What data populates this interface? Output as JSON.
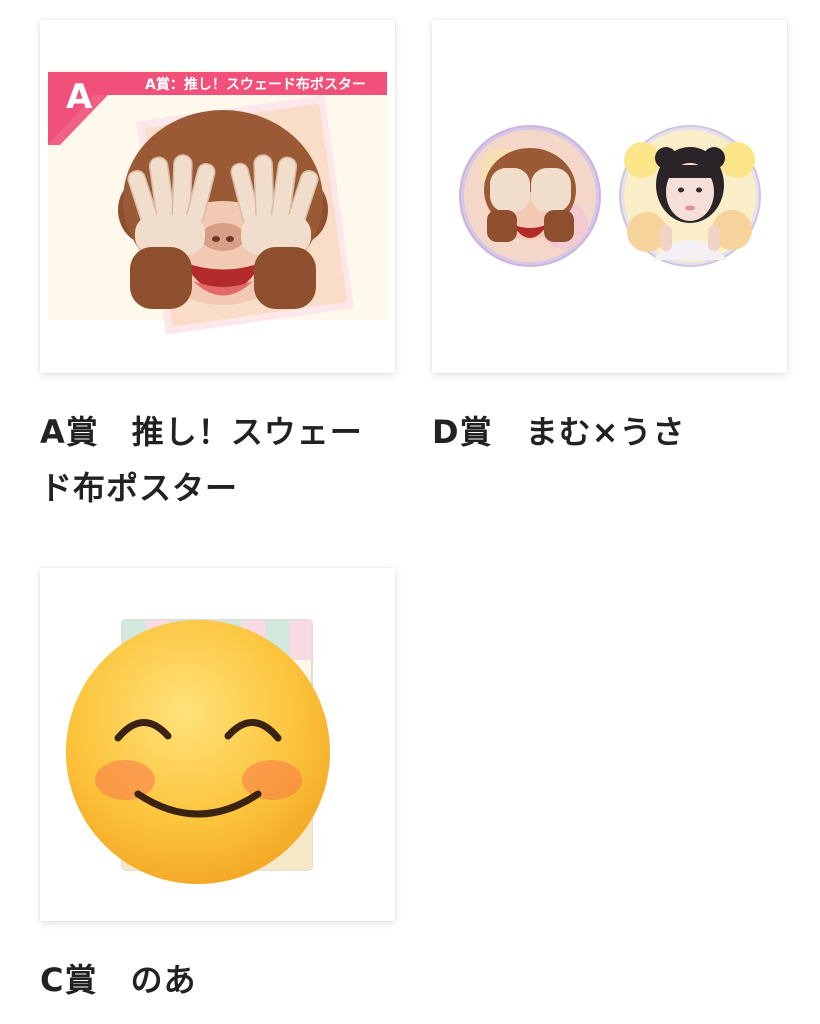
{
  "items": [
    {
      "prize_letter": "A",
      "image_banner": "A賞：推し！スウェード布ポスター",
      "caption_line1": "A賞　推し！スウェー",
      "caption_line2": "ド布ポスター"
    },
    {
      "caption_line1": "D賞　まむ×うさ"
    },
    {
      "caption_line1": "C賞　のあ"
    }
  ],
  "colors": {
    "banner_pink": "#f0507a",
    "card_bg": "#ffffff"
  },
  "icons": {
    "item_a": "see-no-evil-monkey-icon",
    "item_d_left": "see-no-evil-monkey-icon",
    "item_d_right": "photo-portrait",
    "item_c": "smiling-face-icon"
  }
}
